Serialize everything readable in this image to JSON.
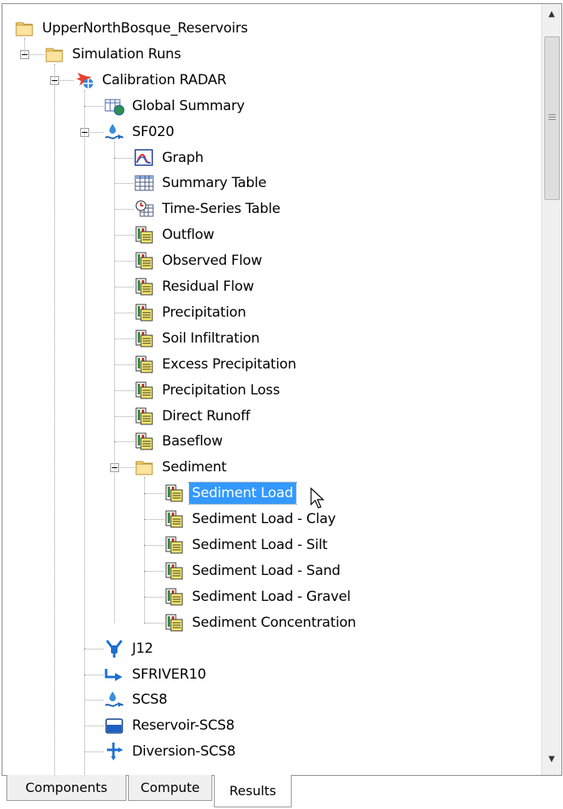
{
  "tree": [
    {
      "label": "UpperNorthBosque_Reservoirs",
      "icon": "folder-icon",
      "level": 0,
      "toggle": false,
      "selected": false
    },
    {
      "label": "Simulation Runs",
      "icon": "folder-icon",
      "level": 1,
      "toggle": true,
      "selected": false
    },
    {
      "label": "Calibration RADAR",
      "icon": "simulation-run-icon",
      "level": 2,
      "toggle": true,
      "selected": false
    },
    {
      "label": "Global Summary",
      "icon": "global-summary-icon",
      "level": 3,
      "toggle": false,
      "selected": false
    },
    {
      "label": "SF020",
      "icon": "subbasin-icon",
      "level": 3,
      "toggle": true,
      "selected": false
    },
    {
      "label": "Graph",
      "icon": "graph-icon",
      "level": 4,
      "toggle": false,
      "selected": false
    },
    {
      "label": "Summary Table",
      "icon": "table-icon",
      "level": 4,
      "toggle": false,
      "selected": false
    },
    {
      "label": "Time-Series Table",
      "icon": "time-series-icon",
      "level": 4,
      "toggle": false,
      "selected": false
    },
    {
      "label": "Outflow",
      "icon": "result-icon",
      "level": 4,
      "toggle": false,
      "selected": false
    },
    {
      "label": "Observed Flow",
      "icon": "result-icon",
      "level": 4,
      "toggle": false,
      "selected": false
    },
    {
      "label": "Residual Flow",
      "icon": "result-icon",
      "level": 4,
      "toggle": false,
      "selected": false
    },
    {
      "label": "Precipitation",
      "icon": "result-icon",
      "level": 4,
      "toggle": false,
      "selected": false
    },
    {
      "label": "Soil Infiltration",
      "icon": "result-icon",
      "level": 4,
      "toggle": false,
      "selected": false
    },
    {
      "label": "Excess Precipitation",
      "icon": "result-icon",
      "level": 4,
      "toggle": false,
      "selected": false
    },
    {
      "label": "Precipitation Loss",
      "icon": "result-icon",
      "level": 4,
      "toggle": false,
      "selected": false
    },
    {
      "label": "Direct Runoff",
      "icon": "result-icon",
      "level": 4,
      "toggle": false,
      "selected": false
    },
    {
      "label": "Baseflow",
      "icon": "result-icon",
      "level": 4,
      "toggle": false,
      "selected": false
    },
    {
      "label": "Sediment",
      "icon": "folder-icon",
      "level": 4,
      "toggle": true,
      "selected": false
    },
    {
      "label": "Sediment Load",
      "icon": "result-icon",
      "level": 5,
      "toggle": false,
      "selected": true
    },
    {
      "label": "Sediment Load - Clay",
      "icon": "result-icon",
      "level": 5,
      "toggle": false,
      "selected": false
    },
    {
      "label": "Sediment Load - Silt",
      "icon": "result-icon",
      "level": 5,
      "toggle": false,
      "selected": false
    },
    {
      "label": "Sediment Load - Sand",
      "icon": "result-icon",
      "level": 5,
      "toggle": false,
      "selected": false
    },
    {
      "label": "Sediment Load - Gravel",
      "icon": "result-icon",
      "level": 5,
      "toggle": false,
      "selected": false
    },
    {
      "label": "Sediment Concentration",
      "icon": "result-icon",
      "level": 5,
      "toggle": false,
      "selected": false
    },
    {
      "label": "J12",
      "icon": "junction-icon",
      "level": 3,
      "toggle": false,
      "selected": false
    },
    {
      "label": "SFRIVER10",
      "icon": "reach-icon",
      "level": 3,
      "toggle": false,
      "selected": false
    },
    {
      "label": "SCS8",
      "icon": "subbasin-icon",
      "level": 3,
      "toggle": false,
      "selected": false
    },
    {
      "label": "Reservoir-SCS8",
      "icon": "reservoir-icon",
      "level": 3,
      "toggle": false,
      "selected": false
    },
    {
      "label": "Diversion-SCS8",
      "icon": "diversion-icon",
      "level": 3,
      "toggle": false,
      "selected": false
    }
  ],
  "tabs": [
    {
      "label": "Components",
      "active": false
    },
    {
      "label": "Compute",
      "active": false
    },
    {
      "label": "Results",
      "active": true
    }
  ],
  "scrollbar": {
    "up_glyph": "▲",
    "down_glyph": "▼"
  },
  "colors": {
    "selection": "#3399ff",
    "folder": "#f5d37a",
    "result_green": "#3c8f3c",
    "result_yellow": "#f7e86b"
  }
}
